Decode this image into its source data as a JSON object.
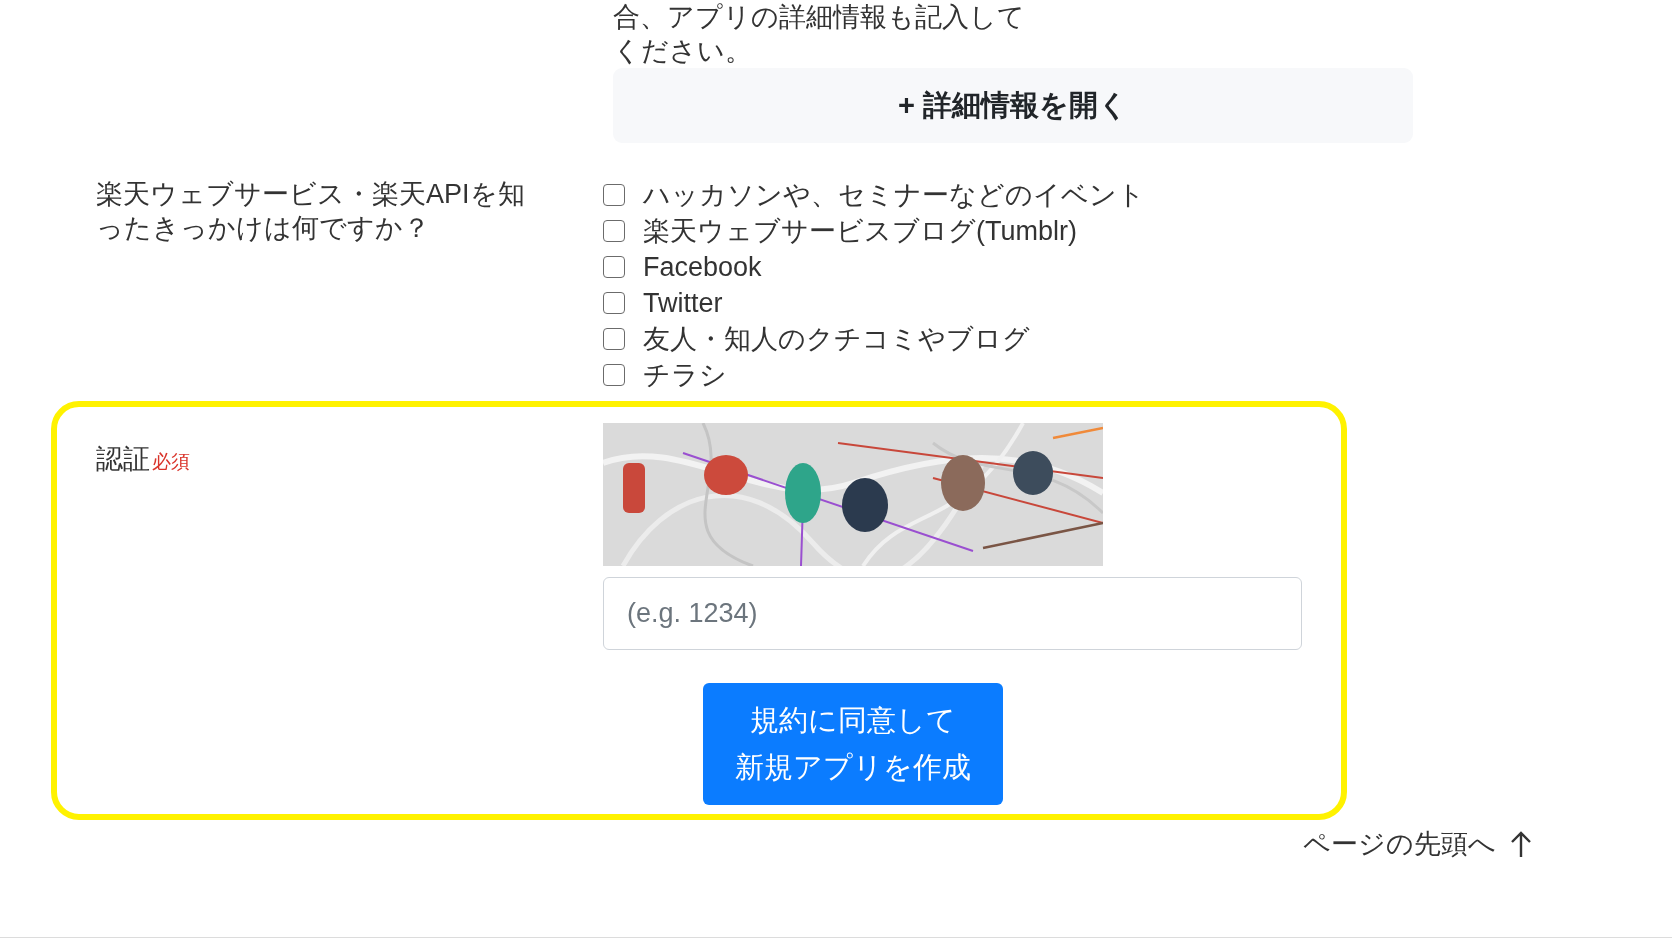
{
  "details_section": {
    "note": "合、アプリの詳細情報も記入してください。",
    "expand_button": "+ 詳細情報を開く"
  },
  "referral_question": {
    "label": "楽天ウェブサービス・楽天APIを知ったきっかけは何ですか？",
    "options": [
      {
        "label": "ハッカソンや、セミナーなどのイベント",
        "checked": false
      },
      {
        "label": "楽天ウェブサービスブログ(Tumblr)",
        "checked": false
      },
      {
        "label": "Facebook",
        "checked": false
      },
      {
        "label": "Twitter",
        "checked": false
      },
      {
        "label": "友人・知人のクチコミやブログ",
        "checked": false
      },
      {
        "label": "チラシ",
        "checked": false
      }
    ]
  },
  "captcha": {
    "label": "認証",
    "required_badge": "必須",
    "input": {
      "placeholder": "(e.g. 1234)"
    }
  },
  "submit_button": {
    "lines": [
      "規約に同意して",
      "新規アプリを作成"
    ]
  },
  "back_to_top": {
    "label": "ページの先頭へ"
  }
}
